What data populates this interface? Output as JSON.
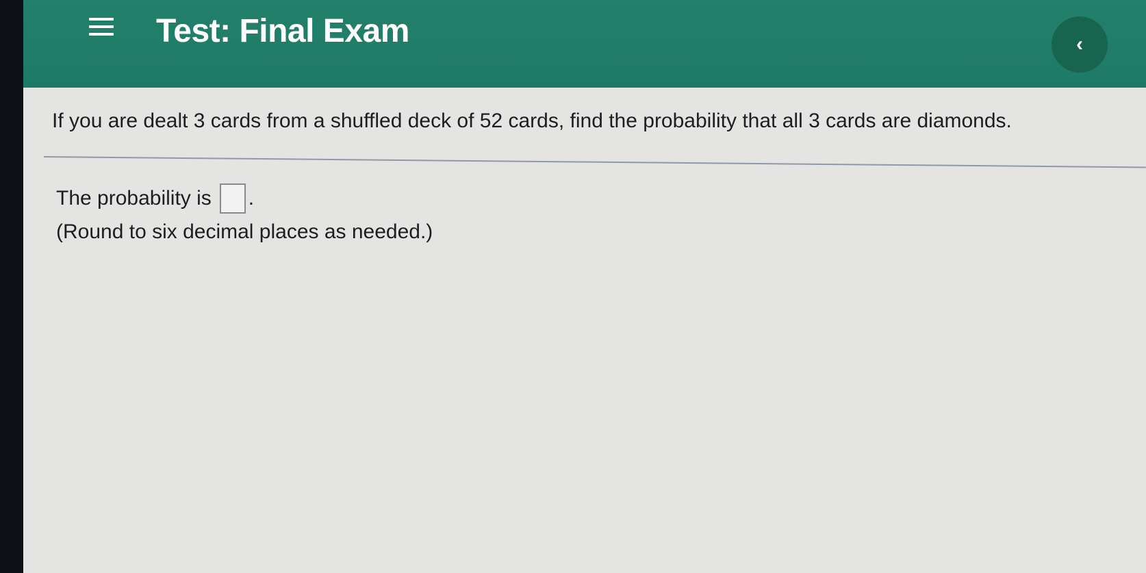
{
  "header": {
    "title": "Test:  Final Exam",
    "menu_icon": "hamburger-menu-icon",
    "back_icon": "chevron-left-icon",
    "back_glyph": "‹",
    "background_color": "#1f7d66"
  },
  "question": {
    "text": "If you are dealt 3 cards from a shuffled deck of 52 cards, find the probability that all 3 cards are diamonds."
  },
  "answer": {
    "prefix": "The probability is",
    "value": "",
    "suffix": ".",
    "instruction": "(Round to six decimal places as needed.)"
  }
}
